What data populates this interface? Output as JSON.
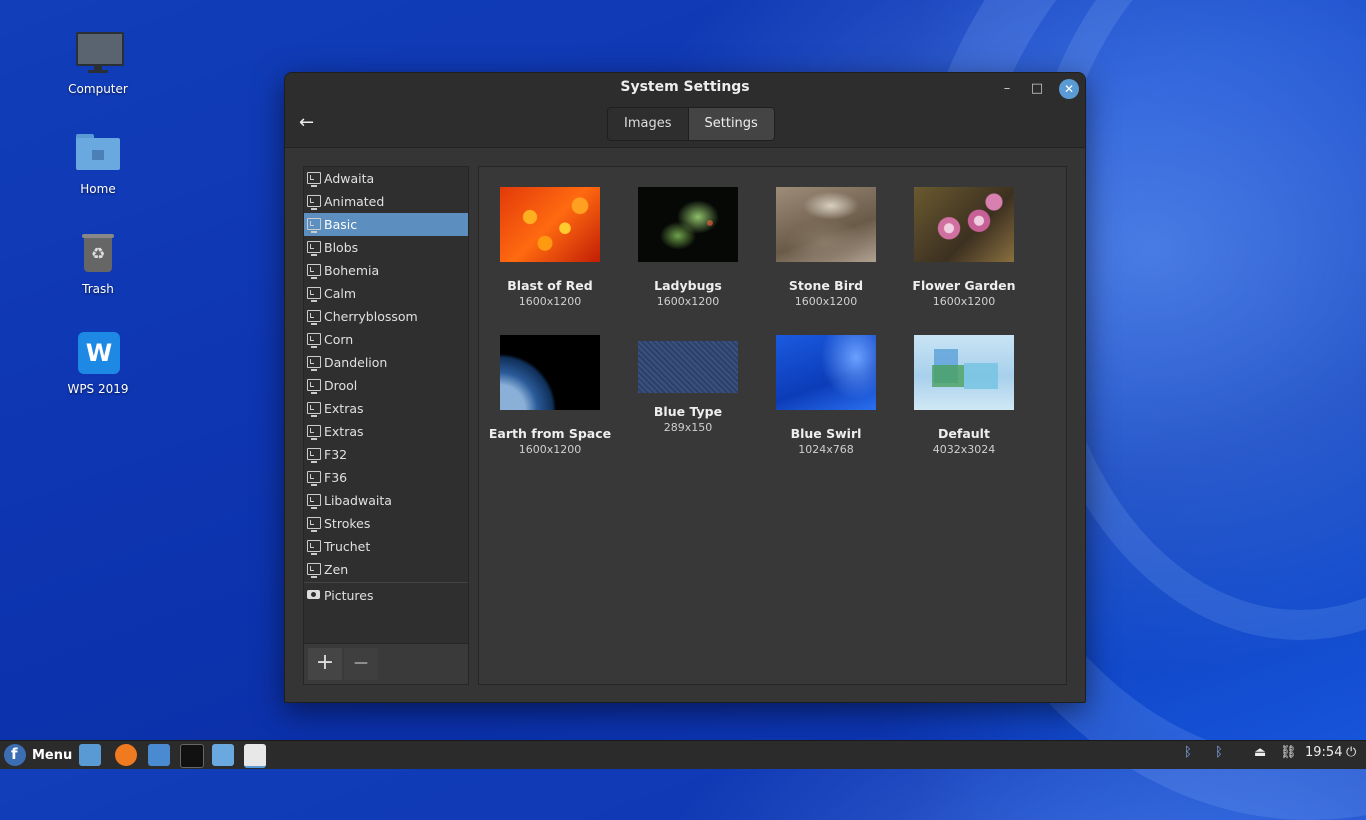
{
  "desktop": {
    "icons": [
      {
        "label": "Computer"
      },
      {
        "label": "Home"
      },
      {
        "label": "Trash"
      },
      {
        "label": "WPS 2019"
      }
    ]
  },
  "window": {
    "title": "System Settings",
    "minimize": "–",
    "maximize": "□",
    "close": "✕",
    "back": "←",
    "tabs": [
      {
        "label": "Images"
      },
      {
        "label": "Settings"
      }
    ]
  },
  "sidebar": {
    "items": [
      {
        "label": "Adwaita"
      },
      {
        "label": "Animated"
      },
      {
        "label": "Basic"
      },
      {
        "label": "Blobs"
      },
      {
        "label": "Bohemia"
      },
      {
        "label": "Calm"
      },
      {
        "label": "Cherryblossom"
      },
      {
        "label": "Corn"
      },
      {
        "label": "Dandelion"
      },
      {
        "label": "Drool"
      },
      {
        "label": "Extras"
      },
      {
        "label": "Extras"
      },
      {
        "label": "F32"
      },
      {
        "label": "F36"
      },
      {
        "label": "Libadwaita"
      },
      {
        "label": "Strokes"
      },
      {
        "label": "Truchet"
      },
      {
        "label": "Zen"
      }
    ],
    "pictures": "Pictures",
    "add": "+",
    "remove": "—"
  },
  "wallpapers": [
    {
      "name": "Blast of Red",
      "size": "1600x1200"
    },
    {
      "name": "Ladybugs",
      "size": "1600x1200"
    },
    {
      "name": "Stone Bird",
      "size": "1600x1200"
    },
    {
      "name": "Flower Garden",
      "size": "1600x1200"
    },
    {
      "name": "Earth from Space",
      "size": "1600x1200"
    },
    {
      "name": "Blue Type",
      "size": "289x150"
    },
    {
      "name": "Blue Swirl",
      "size": "1024x768"
    },
    {
      "name": "Default",
      "size": "4032x3024"
    }
  ],
  "panel": {
    "menu": "Menu",
    "clock": "19:54"
  }
}
